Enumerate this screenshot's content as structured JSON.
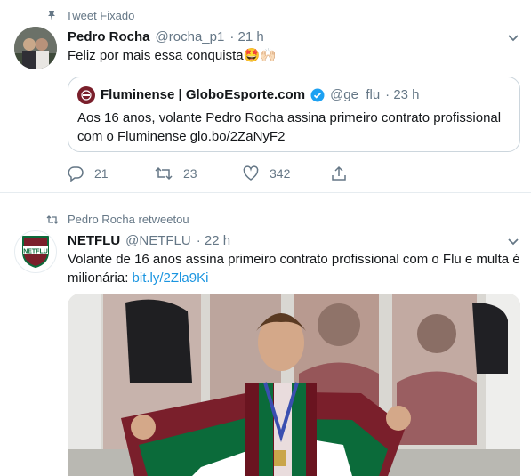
{
  "tweet1": {
    "pinned_label": "Tweet Fixado",
    "name": "Pedro Rocha",
    "handle": "@rocha_p1",
    "time": "· 21 h",
    "text": "Feliz por mais essa conquista",
    "emoji": "🤩🙌🏻",
    "quoted": {
      "name": "Fluminense | GloboEsporte.com",
      "handle": "@ge_flu",
      "time": "· 23 h",
      "text_line1": "Aos 16 anos, volante Pedro Rocha assina primeiro contrato profissional",
      "text_line2": "com o Fluminense glo.bo/2ZaNyF2"
    },
    "actions": {
      "replies": "21",
      "retweets": "23",
      "likes": "342"
    }
  },
  "tweet2": {
    "retweeted_label": "Pedro Rocha retweetou",
    "name": "NETFLU",
    "handle": "@NETFLU",
    "time": "· 22 h",
    "text_line1": "Volante de 16 anos assina primeiro contrato profissional com o Flu e multa é",
    "text_line2_prefix": "milionária: ",
    "link": "bit.ly/2Zla9Ki",
    "avatar_text": "NETFLU"
  },
  "colors": {
    "link": "#1b95e0",
    "secondary": "#657786",
    "fluminense_garnet": "#7a1f2b",
    "fluminense_green": "#0b6b3a",
    "verified": "#1da1f2"
  }
}
